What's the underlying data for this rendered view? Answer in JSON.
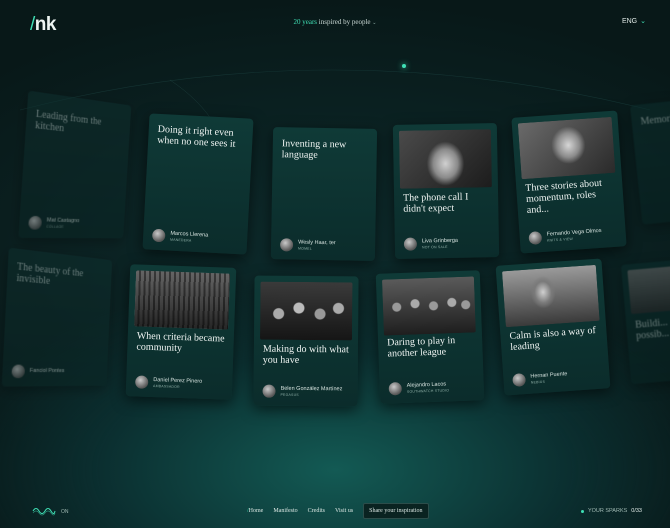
{
  "header": {
    "logo_slash": "/",
    "logo_text": "nk",
    "tagline_highlight": "20 years",
    "tagline_rest": "inspired by people",
    "tagline_icon": "chevron-down-icon",
    "language": "ENG",
    "language_icon": "chevron-down-icon"
  },
  "accent_color": "#3fe0b5",
  "cards_top": [
    {
      "title": "Leading from the kitchen",
      "author": "Mat Castagno",
      "role": "COLLAGE",
      "faded": true
    },
    {
      "title": "Doing it right even when no one sees it",
      "author": "Marcos Llerena",
      "role": "MANEDERA"
    },
    {
      "title": "Inventing a new language",
      "author": "Wesly Haar, ter",
      "role": "MOMEL"
    },
    {
      "title": "The phone call I didn't expect",
      "author": "Liva Grinberga",
      "role": "NOT ON SALE"
    },
    {
      "title": "Three stories about momentum, roles and...",
      "author": "Fernando Vega Olmos",
      "role": "KNITS & VIEW"
    },
    {
      "title": "Memories",
      "author": "",
      "role": "",
      "faded": true
    }
  ],
  "cards_bottom": [
    {
      "title": "The beauty of the invisible",
      "author": "Fanciol Pontes",
      "role": "",
      "faded": true
    },
    {
      "title": "When criteria became community",
      "author": "Daniel Perez Pinero",
      "role": "AMBASSADOR"
    },
    {
      "title": "Making do with what you have",
      "author": "Belen González Martínez",
      "role": "PEGASUS"
    },
    {
      "title": "Daring to play in another league",
      "author": "Alejandro Lacos",
      "role": "SOUTHWATCH STUDIO"
    },
    {
      "title": "Calm is also a way of leading",
      "author": "Hernan Puente",
      "role": "NEBIUS"
    },
    {
      "title": "Buildi... possib...",
      "author": "",
      "role": "",
      "faded": true
    }
  ],
  "footer": {
    "sound_icon": "sound-wave-icon",
    "sound_state": "ON",
    "nav_slash": "/",
    "nav_home": "Home",
    "nav_manifesto": "Manifesto",
    "nav_credits": "Credits",
    "nav_visit": "Visit us",
    "share_button": "Share your inspiration",
    "sparks_label": "YOUR SPARKS",
    "sparks_count": "0/33"
  }
}
